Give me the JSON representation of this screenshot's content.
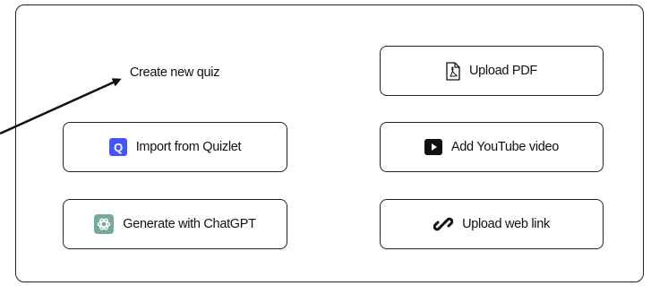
{
  "panel": {
    "create_quiz": "Create new quiz",
    "buttons": {
      "quizlet": {
        "label": "Import from Quizlet",
        "icon": "quizlet-icon",
        "color": "#4255ff",
        "glyph": "Q"
      },
      "chatgpt": {
        "label": "Generate with ChatGPT",
        "icon": "chatgpt-icon",
        "color": "#74aa9c"
      },
      "pdf": {
        "label": "Upload PDF",
        "icon": "pdf-file-icon"
      },
      "youtube": {
        "label": "Add YouTube video",
        "icon": "youtube-icon",
        "color": "#111111"
      },
      "weblink": {
        "label": "Upload web link",
        "icon": "link-icon"
      }
    }
  },
  "colors": {
    "border": "#222222",
    "text": "#111111",
    "background": "#ffffff"
  }
}
